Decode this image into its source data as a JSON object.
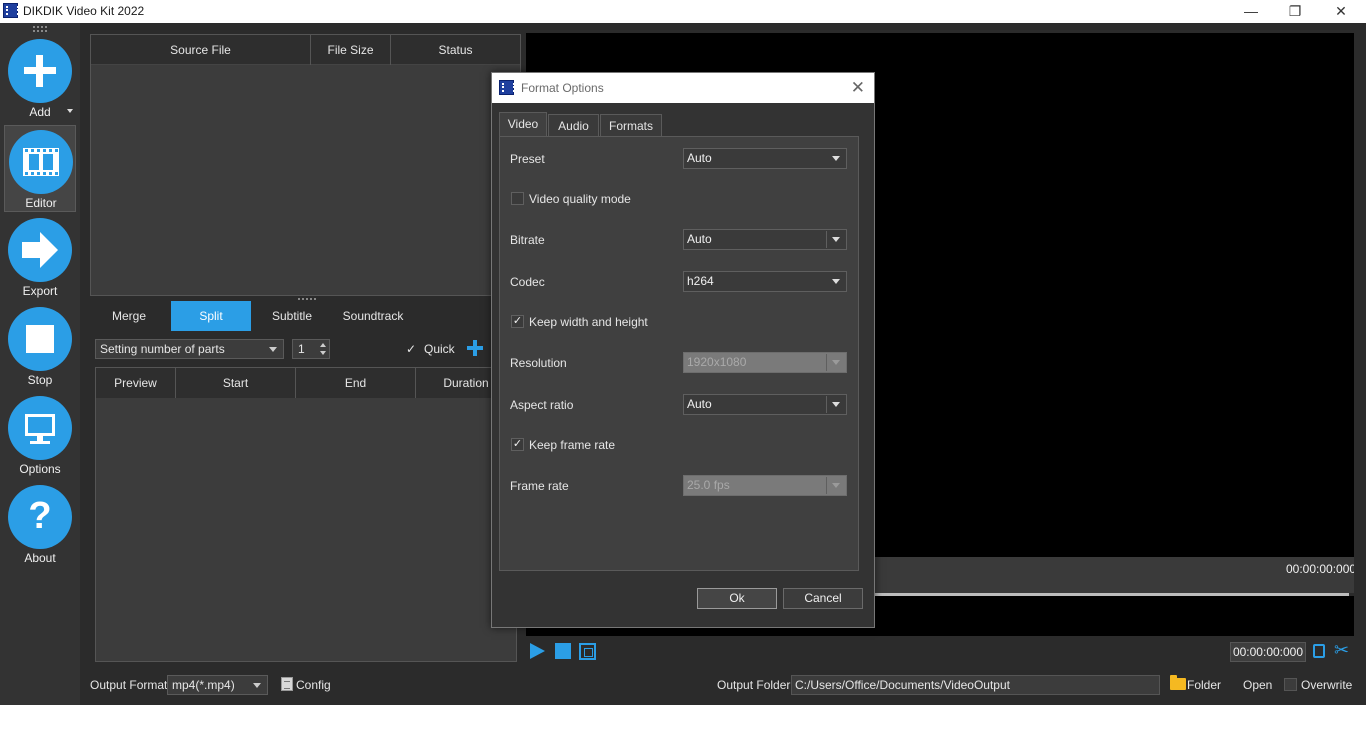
{
  "window": {
    "title": "DIKDIK Video Kit 2022",
    "minimize": "—",
    "maximize": "❐",
    "close": "✕"
  },
  "sidebar": {
    "items": [
      {
        "label": "Add",
        "icon": "plus-icon"
      },
      {
        "label": "Editor",
        "icon": "film-icon",
        "selected": true
      },
      {
        "label": "Export",
        "icon": "arrow-right-icon"
      },
      {
        "label": "Stop",
        "icon": "stop-icon"
      },
      {
        "label": "Options",
        "icon": "monitor-icon"
      },
      {
        "label": "About",
        "icon": "question-icon",
        "glyph": "?"
      }
    ]
  },
  "source_table": {
    "columns": [
      "Source File",
      "File Size",
      "Status"
    ],
    "rows": []
  },
  "mode_tabs": [
    {
      "label": "Merge"
    },
    {
      "label": "Split",
      "active": true
    },
    {
      "label": "Subtitle"
    },
    {
      "label": "Soundtrack"
    }
  ],
  "split": {
    "mode_value": "Setting number of parts",
    "parts_count": "1",
    "quick_checked": true,
    "quick_check_glyph": "✓",
    "quick_label": "Quick",
    "columns": [
      "Preview",
      "Start",
      "End",
      "Duration"
    ]
  },
  "player": {
    "time_display_top": "00:00:00:000",
    "time_box": "00:00:00:000",
    "scissors_glyph": "✂"
  },
  "bottom": {
    "output_format_label": "Output Format",
    "output_format_value": "mp4(*.mp4)",
    "config_label": "Config",
    "output_folder_label": "Output Folder",
    "output_folder_path": "C:/Users/Office/Documents/VideoOutput",
    "folder_button": "Folder",
    "open_button": "Open",
    "overwrite_label": "Overwrite",
    "overwrite_checked": false
  },
  "dialog": {
    "title": "Format Options",
    "close_glyph": "✕",
    "tabs": [
      {
        "label": "Video",
        "active": true
      },
      {
        "label": "Audio"
      },
      {
        "label": "Formats"
      }
    ],
    "check_glyph": "✓",
    "fields": {
      "preset": {
        "label": "Preset",
        "value": "Auto"
      },
      "video_quality_mode": {
        "label": "Video quality mode",
        "checked": false
      },
      "bitrate": {
        "label": "Bitrate",
        "value": "Auto"
      },
      "codec": {
        "label": "Codec",
        "value": "h264"
      },
      "keep_width_height": {
        "label": "Keep width and height",
        "checked": true
      },
      "resolution": {
        "label": "Resolution",
        "value": "1920x1080",
        "disabled": true
      },
      "aspect_ratio": {
        "label": "Aspect ratio",
        "value": "Auto"
      },
      "keep_frame_rate": {
        "label": "Keep frame rate",
        "checked": true
      },
      "frame_rate": {
        "label": "Frame rate",
        "value": "25.0 fps",
        "disabled": true
      }
    },
    "ok_label": "Ok",
    "cancel_label": "Cancel"
  },
  "colors": {
    "accent": "#2b9ee6",
    "background": "#2b2b2b",
    "panel": "#3c3c3c",
    "folder": "#f5b921"
  }
}
